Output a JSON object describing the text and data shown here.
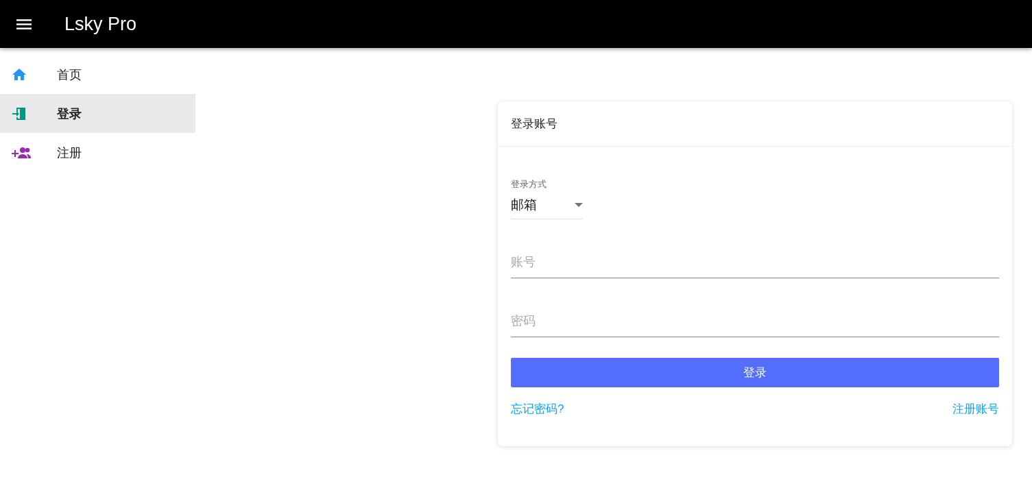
{
  "app_bar": {
    "title": "Lsky Pro"
  },
  "sidebar": {
    "items": [
      {
        "kind": "home",
        "label": "首页",
        "selected": false,
        "color": "#2196f3"
      },
      {
        "kind": "login",
        "label": "登录",
        "selected": true,
        "color": "#009688"
      },
      {
        "kind": "register",
        "label": "注册",
        "selected": false,
        "color": "#9c27b0"
      }
    ]
  },
  "login_card": {
    "title": "登录账号",
    "method_select": {
      "label": "登录方式",
      "value": "邮箱"
    },
    "fields": [
      {
        "placeholder": "账号"
      },
      {
        "placeholder": "密码"
      }
    ],
    "submit_button": "登录",
    "links": [
      "忘记密码?",
      "注册账号"
    ]
  }
}
